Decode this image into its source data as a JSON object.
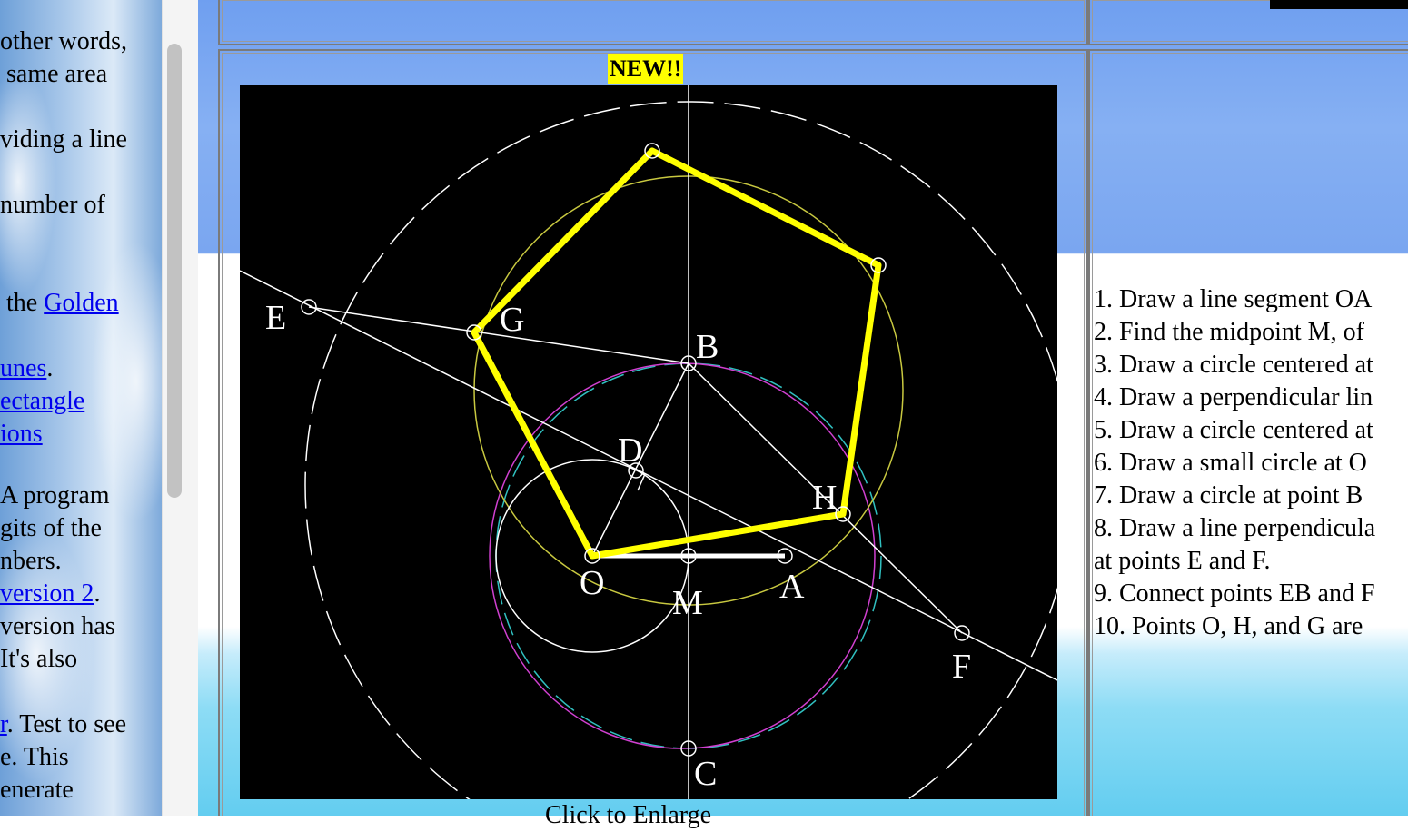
{
  "left_panel": {
    "lines": [
      {
        "text": "other words,"
      },
      {
        "text": " same area"
      },
      {
        "text": "viding a line"
      },
      {
        "text": "number of"
      },
      {
        "pre": " the ",
        "link": "Golden"
      },
      {
        "link": "unes",
        "post": "."
      },
      {
        "link": "ectangle"
      },
      {
        "link": "ions"
      },
      {
        "text": "A program"
      },
      {
        "text": "gits of the"
      },
      {
        "text": "nbers."
      },
      {
        "link": "version 2",
        "post": "."
      },
      {
        "text": "version has"
      },
      {
        "text": "It's also"
      },
      {
        "link": "r",
        "post": ". Test to see"
      },
      {
        "text": "e. This"
      },
      {
        "text": "enerate"
      }
    ]
  },
  "badge": {
    "label": "NEW!!"
  },
  "figure": {
    "point_labels": {
      "E": "E",
      "G": "G",
      "B": "B",
      "D": "D",
      "H": "H",
      "O": "O",
      "M": "M",
      "A": "A",
      "F": "F",
      "C": "C"
    }
  },
  "caption": {
    "text": "Click to Enlarge"
  },
  "steps": [
    "1. Draw a line segment OA",
    "2. Find the midpoint M, of",
    "3. Draw a circle centered at",
    "4. Draw a perpendicular lin",
    "5. Draw a circle centered at",
    "6. Draw a small circle at O",
    "7. Draw a circle at point B",
    "8. Draw a line perpendicula",
    "at points E and F.",
    "9. Connect points EB and F",
    "10. Points O, H, and G are"
  ],
  "colors": {
    "pentagon": "#ffff00",
    "circle_yellow": "#c8c840",
    "circle_magenta": "#d040d0",
    "circle_cyan": "#30c0c0",
    "construction": "#ffffff",
    "link": "#0000ee"
  }
}
